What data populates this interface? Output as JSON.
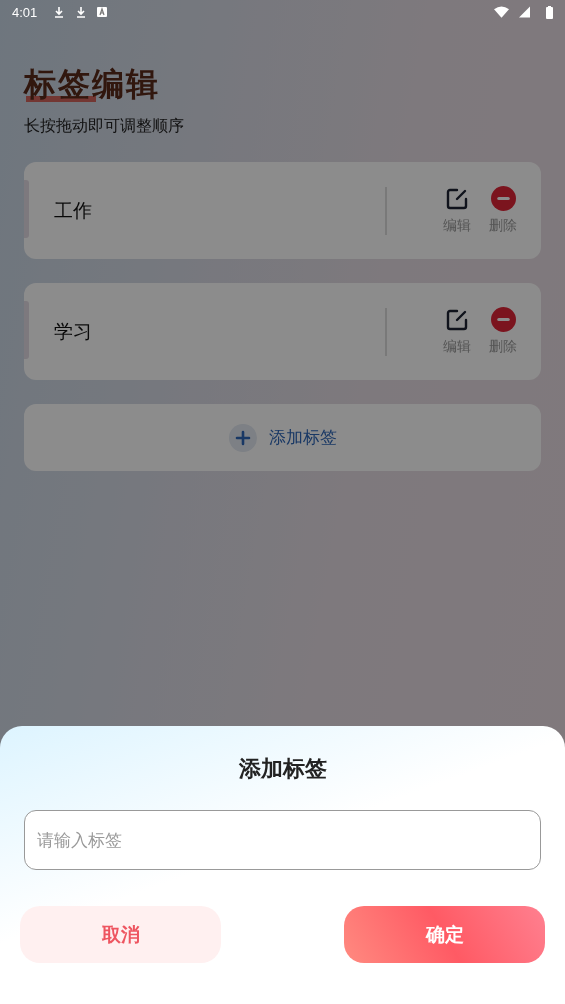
{
  "status_bar": {
    "time": "4:01"
  },
  "header": {
    "title": "标签编辑",
    "subtitle": "长按拖动即可调整顺序"
  },
  "tags": [
    {
      "name": "工作",
      "edit_label": "编辑",
      "delete_label": "删除"
    },
    {
      "name": "学习",
      "edit_label": "编辑",
      "delete_label": "删除"
    }
  ],
  "add_button": {
    "label": "添加标签"
  },
  "dialog": {
    "title": "添加标签",
    "input": {
      "placeholder": "请输入标签"
    },
    "cancel": "取消",
    "confirm": "确定"
  }
}
